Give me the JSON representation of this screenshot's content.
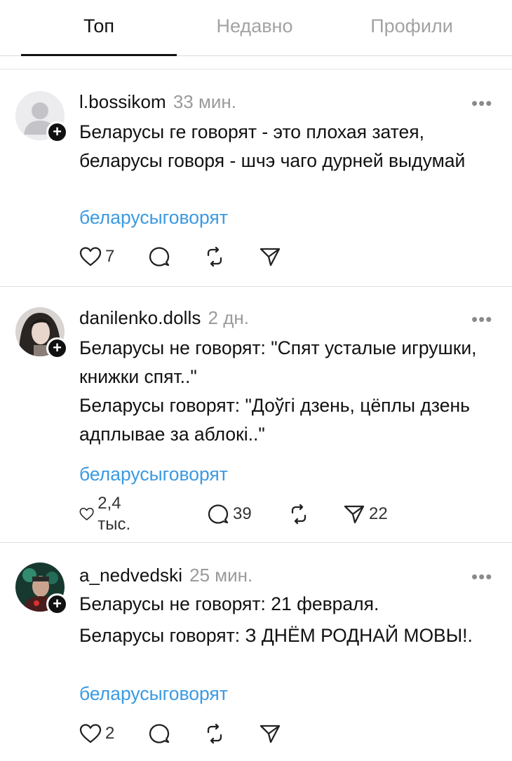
{
  "tabs": [
    {
      "label": "Топ"
    },
    {
      "label": "Недавно"
    },
    {
      "label": "Профили"
    }
  ],
  "more_glyph": "•••",
  "follow_glyph": "+",
  "posts": [
    {
      "username": "l.bossikom",
      "time": "33 мин.",
      "paragraphs": [
        "Беларусы ге говорят - это плохая затея, беларусы говоря - шчэ чаго дурней выдумай"
      ],
      "tag": "беларусыговорят",
      "likes": "7",
      "comments": "",
      "reposts": "",
      "shares": "",
      "avatar": "default-avatar"
    },
    {
      "username": "danilenko.dolls",
      "time": "2 дн.",
      "paragraphs": [
        "Беларусы не говорят: \"Спят усталые игрушки, книжки спят..\"",
        "Беларусы говорят: \"Доўгі дзень, цёплы дзень адплывае за аблокі..\""
      ],
      "tag": "беларусыговорят",
      "likes": "2,4 тыс.",
      "comments": "39",
      "reposts": "",
      "shares": "22",
      "avatar": "photo-avatar"
    },
    {
      "username": "a_nedvedski",
      "time": "25 мин.",
      "paragraphs": [
        "Беларусы не говорят: 21 февраля.",
        "Беларусы говорят: З ДНЁМ РОДНАЙ МОВЫ!."
      ],
      "tag": "беларусыговорят",
      "likes": "2",
      "comments": "",
      "reposts": "",
      "shares": "",
      "avatar": "photo-avatar"
    }
  ],
  "colors": {
    "link": "#3b9ae1",
    "muted": "#9a9a9a",
    "text": "#111111"
  }
}
